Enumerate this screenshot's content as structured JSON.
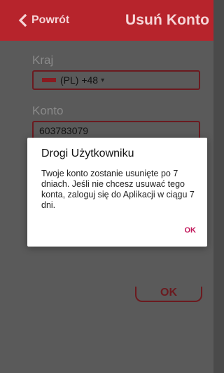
{
  "header": {
    "back_label": "Powrót",
    "title": "Usuń Konto"
  },
  "form": {
    "country_label": "Kraj",
    "country_value": "(PL) +48",
    "account_label": "Konto",
    "account_value": "603783079",
    "ok_button_label": "OK"
  },
  "dialog": {
    "title": "Drogi Użytkowniku",
    "message": "Twoje konto zostanie usunięte po 7 dniach. Jeśli nie chcesz usuwać tego konta, zaloguj się do Aplikacji w ciągu 7 dni.",
    "ok_label": "OK"
  },
  "colors": {
    "header_bg": "#b7242c",
    "accent": "#c2185b"
  },
  "icons": {
    "back": "chevron-left-icon",
    "dropdown": "caret-down-icon"
  }
}
